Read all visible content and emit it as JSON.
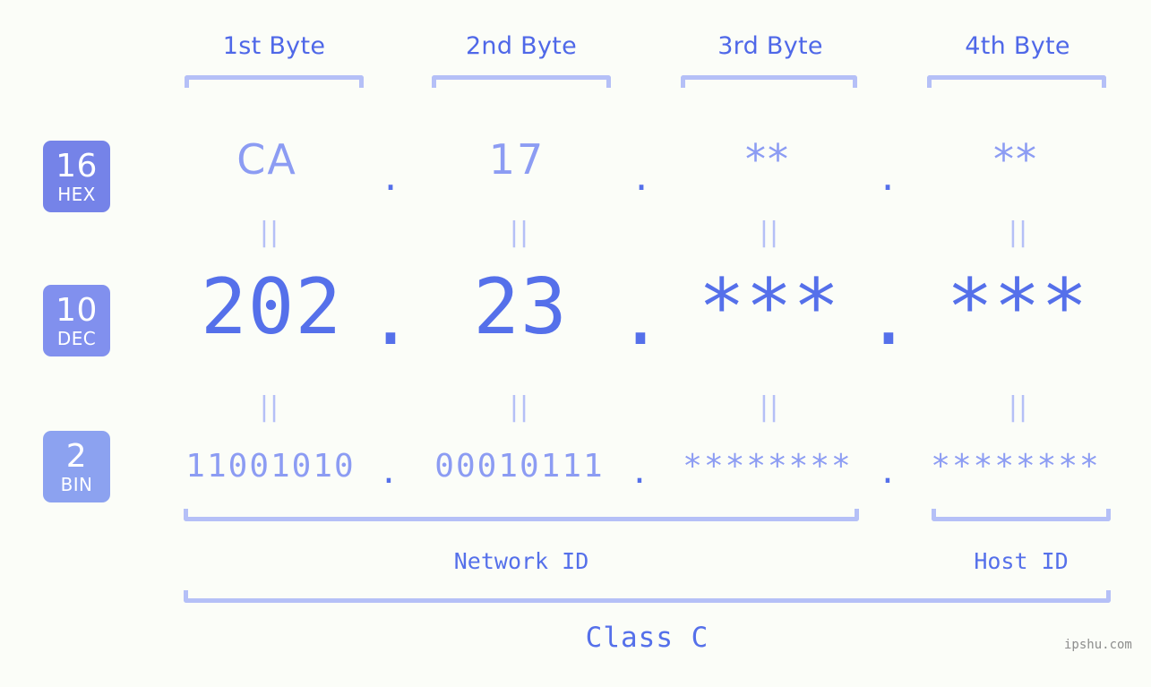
{
  "meta": {
    "background": "#fbfdf8",
    "accent": "#5570ea",
    "accent_light": "#8c9cf3",
    "bracket": "#b5c0f7",
    "watermark_text": "ipshu.com"
  },
  "byte_headers": [
    {
      "label": "1st Byte"
    },
    {
      "label": "2nd Byte"
    },
    {
      "label": "3rd Byte"
    },
    {
      "label": "4th Byte"
    }
  ],
  "bases": [
    {
      "num": "16",
      "label": "HEX",
      "color": "#7583e8"
    },
    {
      "num": "10",
      "label": "DEC",
      "color": "#8190ee"
    },
    {
      "num": "2",
      "label": "BIN",
      "color": "#8ca2f0"
    }
  ],
  "rows": {
    "hex": {
      "values": [
        "CA",
        "17",
        "**",
        "**"
      ],
      "separator": "."
    },
    "dec": {
      "values": [
        "202",
        "23",
        "***",
        "***"
      ],
      "separator": "."
    },
    "bin": {
      "values": [
        "11001010",
        "00010111",
        "********",
        "********"
      ],
      "separator": "."
    }
  },
  "equals_marks": {
    "glyph": "||",
    "count_per_row": 4,
    "rows": 2
  },
  "segments": {
    "network_id": "Network ID",
    "host_id": "Host ID",
    "class": "Class C"
  }
}
